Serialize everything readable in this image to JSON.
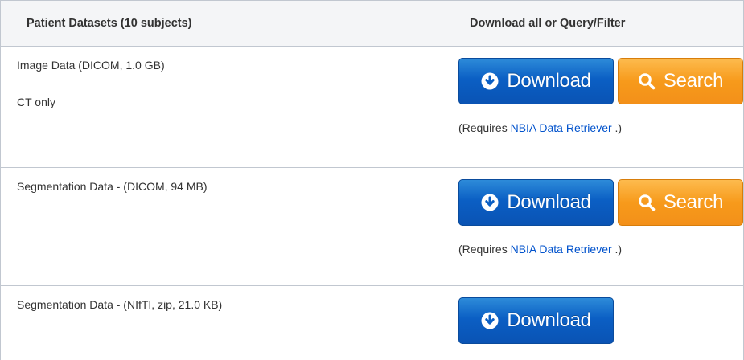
{
  "table": {
    "headers": {
      "left": "Patient Datasets (10 subjects)",
      "right": "Download all or Query/Filter"
    },
    "rows": [
      {
        "lines": [
          "Image Data (DICOM, 1.0 GB)",
          "CT only"
        ],
        "buttons": {
          "download": "Download",
          "search": "Search"
        },
        "note": {
          "prefix": "(Requires ",
          "link": "NBIA Data Retriever",
          "suffix": " .)"
        }
      },
      {
        "lines": [
          "Segmentation Data - (DICOM, 94 MB)"
        ],
        "buttons": {
          "download": "Download",
          "search": "Search"
        },
        "note": {
          "prefix": "(Requires ",
          "link": "NBIA Data Retriever",
          "suffix": " .)"
        }
      },
      {
        "lines": [
          "Segmentation Data - (NIfTI, zip, 21.0 KB)"
        ],
        "buttons": {
          "download": "Download"
        }
      }
    ]
  },
  "colors": {
    "download_button": "#0b5fc4",
    "search_button": "#f79a1b",
    "link": "#0052cc",
    "header_bg": "#f4f5f7",
    "border": "#c1c7d0"
  },
  "icons": {
    "download": "circle-arrow-down-icon",
    "search": "magnifier-icon"
  }
}
